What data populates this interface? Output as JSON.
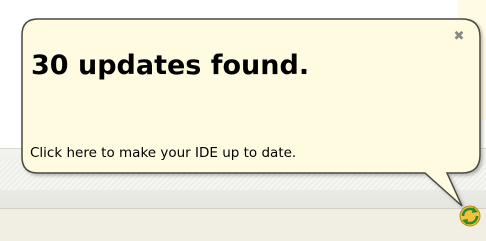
{
  "balloon": {
    "title": "30 updates found.",
    "message": "Click here to make your IDE up to date.",
    "close_icon": "✖",
    "background_color": "#fffbe0",
    "border_color": "#4a4a40"
  },
  "tray": {
    "icon_name": "update-available-icon"
  }
}
